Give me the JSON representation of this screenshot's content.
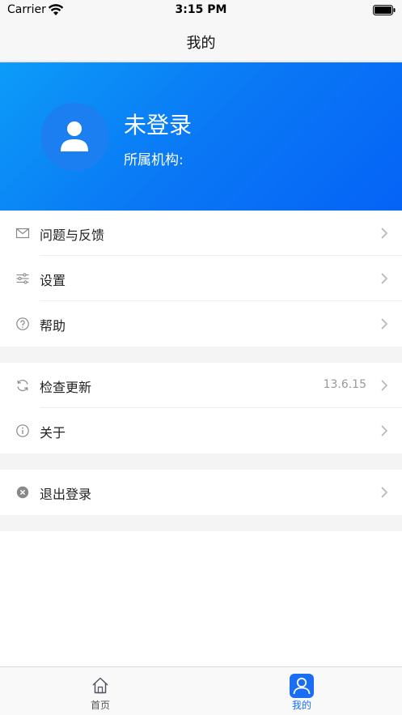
{
  "status_bar": {
    "carrier": "Carrier",
    "time": "3:15 PM"
  },
  "nav": {
    "title": "我的"
  },
  "profile": {
    "name": "未登录",
    "org_label": "所属机构:"
  },
  "menu_group_1": [
    {
      "label": "问题与反馈",
      "icon": "mail-icon"
    },
    {
      "label": "设置",
      "icon": "sliders-icon"
    },
    {
      "label": "帮助",
      "icon": "help-circle-icon"
    }
  ],
  "menu_group_2": [
    {
      "label": "检查更新",
      "value": "13.6.15",
      "icon": "refresh-icon"
    },
    {
      "label": "关于",
      "icon": "info-circle-icon"
    }
  ],
  "menu_group_3": [
    {
      "label": "退出登录",
      "icon": "close-circle-icon"
    }
  ],
  "tab_bar": {
    "items": [
      {
        "label": "首页",
        "icon": "home-icon",
        "active": false
      },
      {
        "label": "我的",
        "icon": "user-icon",
        "active": true
      }
    ],
    "active_color": "#1a6ef5",
    "inactive_color": "#555555"
  },
  "colors": {
    "header_gradient_start": "#0c9cf8",
    "header_gradient_end": "#0563f6",
    "accent": "#1a6ef5"
  }
}
